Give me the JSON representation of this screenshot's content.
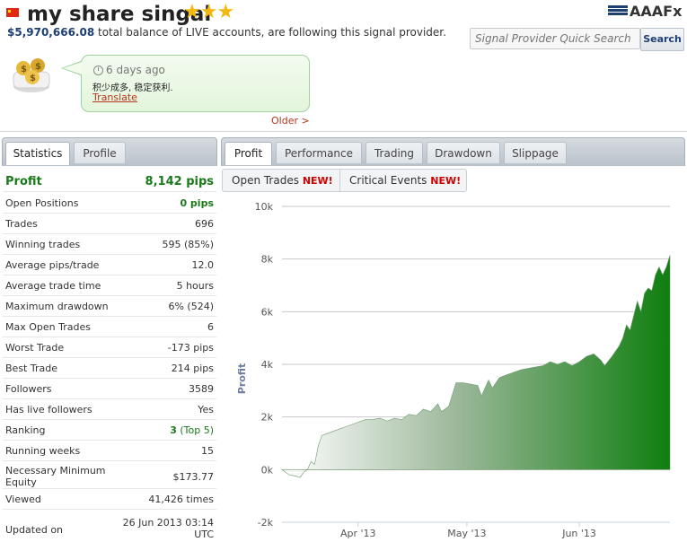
{
  "header": {
    "title": "my share singal",
    "stars": "★★★",
    "balance_amount": "$5,970,666.08",
    "balance_text": "total balance of LIVE accounts, are following this signal provider.",
    "logo_text": "AAAFx",
    "search_placeholder": "Signal Provider Quick Search",
    "search_button": "Search",
    "colors": {
      "brand": "#1d3f73",
      "star": "#f3b80e"
    }
  },
  "message": {
    "time": "6 days ago",
    "text": "积少成多, 稳定获利.",
    "translate_label": "Translate",
    "older_label": "Older >"
  },
  "left_tabs": [
    {
      "label": "Statistics",
      "active": true
    },
    {
      "label": "Profile",
      "active": false
    }
  ],
  "right_tabs": [
    {
      "label": "Profit",
      "active": true
    },
    {
      "label": "Performance",
      "active": false
    },
    {
      "label": "Trading",
      "active": false
    },
    {
      "label": "Drawdown",
      "active": false
    },
    {
      "label": "Slippage",
      "active": false
    }
  ],
  "sub_tabs": [
    {
      "label": "Open Trades",
      "badge": "NEW!"
    },
    {
      "label": "Critical Events",
      "badge": "NEW!"
    }
  ],
  "stats": [
    {
      "label": "Profit",
      "value": "8,142 pips"
    },
    {
      "label": "Open Positions",
      "value": "0 pips"
    },
    {
      "label": "Trades",
      "value": "696"
    },
    {
      "label": "Winning trades",
      "value": "595 (85%)"
    },
    {
      "label": "Average pips/trade",
      "value": "12.0"
    },
    {
      "label": "Average trade time",
      "value": "5 hours"
    },
    {
      "label": "Maximum drawdown",
      "value": "6% (524)"
    },
    {
      "label": "Max Open Trades",
      "value": "6"
    },
    {
      "label": "Worst Trade",
      "value": "-173 pips"
    },
    {
      "label": "Best Trade",
      "value": "214 pips"
    },
    {
      "label": "Followers",
      "value": "3589"
    },
    {
      "label": "Has live followers",
      "value": "Yes"
    },
    {
      "label": "Ranking",
      "value": "3",
      "value_extra": "(Top 5)"
    },
    {
      "label": "Running weeks",
      "value": "15"
    },
    {
      "label": "Necessary Minimum Equity",
      "value": "$173.77"
    },
    {
      "label": "Viewed",
      "value": "41,426 times"
    },
    {
      "label": "Updated on",
      "value": "26 Jun 2013 03:14 UTC"
    }
  ],
  "chart_data": {
    "type": "area",
    "title": "",
    "xlabel": "",
    "ylabel": "Profit",
    "ylim": [
      -2000,
      10000
    ],
    "y_ticks": [
      -2000,
      0,
      2000,
      4000,
      6000,
      8000,
      10000
    ],
    "y_tick_labels": [
      "-2k",
      "0k",
      "2k",
      "4k",
      "6k",
      "8k",
      "10k"
    ],
    "x_tick_labels": [
      "Apr '13",
      "May '13",
      "Jun '13"
    ],
    "x_tick_dates": [
      "2013-04-01",
      "2013-05-01",
      "2013-06-01"
    ],
    "x_range": [
      "2013-03-11",
      "2013-06-26"
    ],
    "grid": true,
    "fill_color": "#1a7f1a",
    "series": [
      {
        "points": [
          [
            "2013-03-11",
            0
          ],
          [
            "2013-03-13",
            -200
          ],
          [
            "2013-03-15",
            -250
          ],
          [
            "2013-03-16",
            -300
          ],
          [
            "2013-03-17",
            -100
          ],
          [
            "2013-03-18",
            0
          ],
          [
            "2013-03-19",
            300
          ],
          [
            "2013-03-20",
            200
          ],
          [
            "2013-03-21",
            900
          ],
          [
            "2013-03-22",
            1300
          ],
          [
            "2013-03-24",
            1400
          ],
          [
            "2013-03-26",
            1500
          ],
          [
            "2013-03-28",
            1600
          ],
          [
            "2013-03-30",
            1700
          ],
          [
            "2013-04-01",
            1800
          ],
          [
            "2013-04-03",
            1900
          ],
          [
            "2013-04-05",
            1900
          ],
          [
            "2013-04-07",
            1950
          ],
          [
            "2013-04-09",
            1850
          ],
          [
            "2013-04-11",
            1950
          ],
          [
            "2013-04-13",
            1900
          ],
          [
            "2013-04-15",
            2100
          ],
          [
            "2013-04-17",
            2050
          ],
          [
            "2013-04-19",
            2300
          ],
          [
            "2013-04-21",
            2200
          ],
          [
            "2013-04-23",
            2500
          ],
          [
            "2013-04-24",
            2200
          ],
          [
            "2013-04-26",
            2400
          ],
          [
            "2013-04-28",
            3300
          ],
          [
            "2013-04-30",
            3300
          ],
          [
            "2013-05-02",
            3250
          ],
          [
            "2013-05-04",
            3200
          ],
          [
            "2013-05-05",
            2800
          ],
          [
            "2013-05-07",
            3400
          ],
          [
            "2013-05-08",
            3100
          ],
          [
            "2013-05-10",
            3500
          ],
          [
            "2013-05-12",
            3600
          ],
          [
            "2013-05-14",
            3700
          ],
          [
            "2013-05-16",
            3800
          ],
          [
            "2013-05-18",
            3850
          ],
          [
            "2013-05-20",
            3900
          ],
          [
            "2013-05-22",
            3950
          ],
          [
            "2013-05-24",
            4100
          ],
          [
            "2013-05-26",
            4000
          ],
          [
            "2013-05-28",
            4100
          ],
          [
            "2013-05-30",
            3950
          ],
          [
            "2013-06-01",
            4100
          ],
          [
            "2013-06-03",
            4300
          ],
          [
            "2013-06-05",
            4400
          ],
          [
            "2013-06-07",
            4150
          ],
          [
            "2013-06-08",
            3950
          ],
          [
            "2013-06-10",
            4300
          ],
          [
            "2013-06-12",
            4700
          ],
          [
            "2013-06-13",
            5000
          ],
          [
            "2013-06-14",
            5500
          ],
          [
            "2013-06-15",
            5300
          ],
          [
            "2013-06-17",
            6400
          ],
          [
            "2013-06-18",
            6000
          ],
          [
            "2013-06-19",
            6700
          ],
          [
            "2013-06-20",
            6900
          ],
          [
            "2013-06-21",
            6800
          ],
          [
            "2013-06-22",
            7400
          ],
          [
            "2013-06-23",
            7700
          ],
          [
            "2013-06-24",
            7400
          ],
          [
            "2013-06-25",
            7700
          ],
          [
            "2013-06-26",
            8142
          ]
        ]
      }
    ]
  }
}
